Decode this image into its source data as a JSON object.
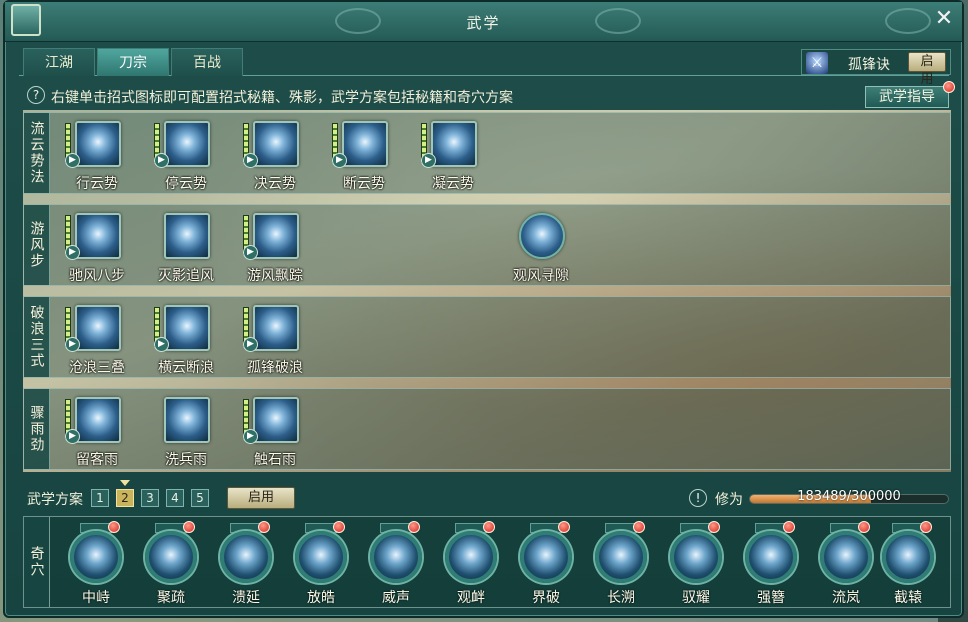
{
  "window": {
    "title": "武学",
    "close_glyph": "✕"
  },
  "tabs": [
    {
      "label": "江湖",
      "active": false
    },
    {
      "label": "刀宗",
      "active": true
    },
    {
      "label": "百战",
      "active": false
    }
  ],
  "top_right": {
    "icon": "person-icon",
    "label": "孤锋诀",
    "button": "启用"
  },
  "hint": {
    "icon_glyph": "?",
    "text": "右键单击招式图标即可配置招式秘籍、殊影，武学方案包括秘籍和奇穴方案"
  },
  "guide_button": "武学指导",
  "rows": [
    {
      "label": "流云势法",
      "skills": [
        {
          "name": "行云势",
          "icon": "swirl-slash-icon",
          "round": false
        },
        {
          "name": "停云势",
          "icon": "burst-icon",
          "round": false
        },
        {
          "name": "决云势",
          "icon": "strike-icon",
          "round": false
        },
        {
          "name": "断云势",
          "icon": "cleave-icon",
          "round": false
        },
        {
          "name": "凝云势",
          "icon": "stance-icon",
          "round": false
        }
      ]
    },
    {
      "label": "游风步",
      "skills": [
        {
          "name": "驰风八步",
          "icon": "dash-icon",
          "round": false
        },
        {
          "name": "灭影追风",
          "icon": "vortex-icon",
          "round": false
        },
        {
          "name": "游风飘踪",
          "icon": "wind-step-icon",
          "round": false
        },
        {
          "name": "观风寻隙",
          "icon": "eye-icon",
          "round": true
        }
      ]
    },
    {
      "label": "破浪三式",
      "skills": [
        {
          "name": "沧浪三叠",
          "icon": "wave-icon",
          "round": false
        },
        {
          "name": "横云断浪",
          "icon": "slash-icon",
          "round": false
        },
        {
          "name": "孤锋破浪",
          "icon": "flash-icon",
          "round": false
        }
      ]
    },
    {
      "label": "骤雨劲",
      "skills": [
        {
          "name": "留客雨",
          "icon": "rain-icon",
          "round": false
        },
        {
          "name": "洗兵雨",
          "icon": "sword-icon",
          "round": false
        },
        {
          "name": "触石雨",
          "icon": "wing-icon",
          "round": false
        }
      ]
    }
  ],
  "plans": {
    "label": "武学方案",
    "numbers": [
      "1",
      "2",
      "3",
      "4",
      "5"
    ],
    "active_index": 1,
    "apply_label": "启用"
  },
  "cultivation": {
    "icon_glyph": "!",
    "label": "修为",
    "value_text": "183489/300000",
    "current": 183489,
    "max": 300000
  },
  "qixue": {
    "label": "奇穴",
    "items": [
      "中峙",
      "聚疏",
      "溃延",
      "放皓",
      "威声",
      "观衅",
      "界破",
      "长溯",
      "驭耀",
      "强簪",
      "流岚",
      "截辕"
    ]
  }
}
